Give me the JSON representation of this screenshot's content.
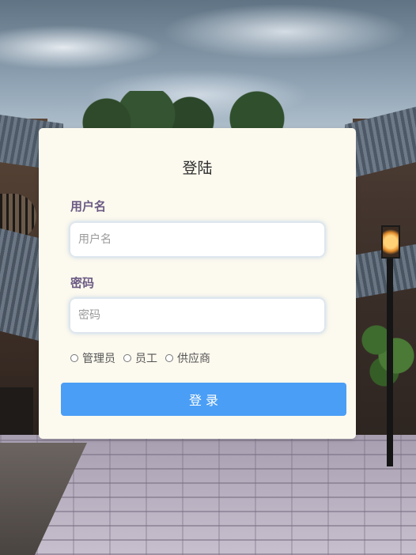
{
  "login": {
    "title": "登陆",
    "username_label": "用户名",
    "username_placeholder": "用户名",
    "username_value": "",
    "password_label": "密码",
    "password_placeholder": "密码",
    "password_value": "",
    "roles": [
      {
        "label": "管理员",
        "checked": false
      },
      {
        "label": "员工",
        "checked": false
      },
      {
        "label": "供应商",
        "checked": false
      }
    ],
    "submit_label": "登 录"
  },
  "theme": {
    "card_bg": "#fcf9ee",
    "label_color": "#6b5a84",
    "button_color": "#4a9ef5"
  }
}
